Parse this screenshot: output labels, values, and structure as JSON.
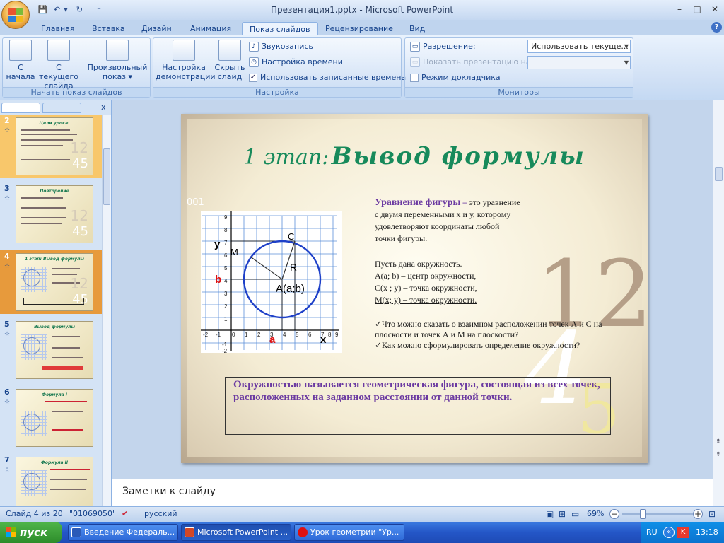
{
  "window": {
    "title": "Презентация1.pptx - Microsoft PowerPoint",
    "minimize": "–",
    "maximize": "□",
    "close": "✕"
  },
  "qat": {
    "save": "💾",
    "undo": "↶",
    "undo_drop": "▾",
    "redo": "↻",
    "customize": "⁼"
  },
  "tabs": [
    {
      "label": "Главная"
    },
    {
      "label": "Вставка"
    },
    {
      "label": "Дизайн"
    },
    {
      "label": "Анимация"
    },
    {
      "label": "Показ слайдов"
    },
    {
      "label": "Рецензирование"
    },
    {
      "label": "Вид"
    }
  ],
  "ribbon": {
    "group_start": {
      "label": "Начать показ слайдов",
      "from_start": "С\nначала",
      "from_start_l1": "С",
      "from_start_l2": "начала",
      "from_current_l1": "С текущего",
      "from_current_l2": "слайда",
      "custom_l1": "Произвольный",
      "custom_l2": "показ ▾"
    },
    "group_setup": {
      "label": "Настройка",
      "setup_l1": "Настройка",
      "setup_l2": "демонстрации",
      "hide_l1": "Скрыть",
      "hide_l2": "слайд",
      "record": "Звукозапись",
      "timing": "Настройка времени",
      "use_timings": "Использовать записанные времена"
    },
    "group_monitors": {
      "label": "Мониторы",
      "resolution_label": "Разрешение:",
      "resolution_value": "Использовать текуще...",
      "show_on_label": "Показать презентацию на:",
      "presenter_view": "Режим докладчика"
    }
  },
  "help": "?",
  "thumbnails": [
    {
      "num": "2",
      "title": "Цели урока:"
    },
    {
      "num": "3",
      "title": "Повторение"
    },
    {
      "num": "4",
      "title": "1 этап: Вывод формулы"
    },
    {
      "num": "5",
      "title": "Вывод формулы"
    },
    {
      "num": "6",
      "title": "Формула I"
    },
    {
      "num": "7",
      "title": "Формула II"
    }
  ],
  "slide": {
    "stage": "1 этап:",
    "title": "Вывод формулы",
    "corner_code": "001",
    "big1": "12",
    "big2": "4",
    "big3": "5",
    "eq_title": "Уравнение фигуры",
    "eq_dash": " – ",
    "eq_text1": "это уравнение",
    "eq_text2": "с двумя переменными х и у, которому",
    "eq_text3": "удовлетворяют координаты любой",
    "eq_text4": "точки фигуры.",
    "circle_given": "Пусть дана окружность.",
    "circle_a": "A(a; b) – центр окружности,",
    "circle_c": "C(x ; y) – точка окружности,",
    "circle_m": "M(x; y) – точка окружности.",
    "q1": "✓Что можно сказать о взаимном расположении точек А и С на плоскости и точек А и М на плоскости?",
    "q2": "✓Как можно сформулировать определение окружности?",
    "definition": "Окружностью называется геометрическая фигура, состоящая из всех точек, расположенных на заданном расстоянии от данной точки.",
    "graph": {
      "x_ticks": [
        "-2",
        "-1",
        "0",
        "1",
        "2",
        "3",
        "4",
        "5",
        "6",
        "7",
        "8",
        "9"
      ],
      "y_ticks": [
        "9",
        "8",
        "7",
        "6",
        "5",
        "4",
        "3",
        "2",
        "1",
        "-1",
        "-2"
      ],
      "label_y": "y",
      "label_x": "x",
      "label_b": "b",
      "label_a": "a",
      "label_m": "M",
      "label_c": "C",
      "label_r": "R",
      "label_center": "A(a;b)"
    }
  },
  "notes": "Заметки к слайду",
  "status": {
    "slide": "Слайд 4 из 20",
    "theme": "\"01069050\"",
    "lang": "русский",
    "zoom": "69%"
  },
  "taskbar": {
    "start": "пуск",
    "tasks": [
      {
        "label": "Введение Федераль..."
      },
      {
        "label": "Microsoft PowerPoint ..."
      },
      {
        "label": "Урок геометрии \"Ур..."
      }
    ],
    "lang": "RU",
    "time": "13:18"
  },
  "colors": {
    "accent_green": "#178a5b",
    "purple": "#6b3aa1",
    "taskbar": "#245edb"
  }
}
